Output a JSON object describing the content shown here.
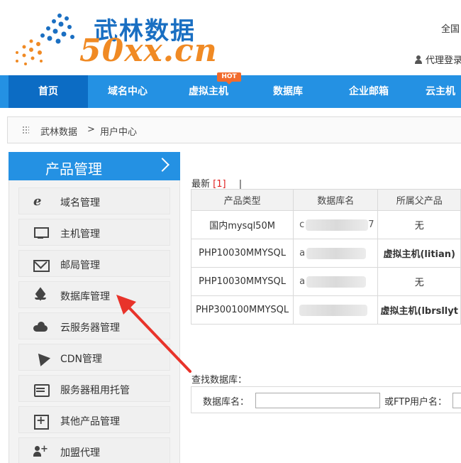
{
  "header": {
    "logo_cn": "武林数据",
    "logo_en": "50xx.cn",
    "top_right_line1": "全国",
    "top_right_line2": "代理登录"
  },
  "nav": {
    "items": [
      {
        "label": "首页",
        "active": true
      },
      {
        "label": "域名中心"
      },
      {
        "label": "虚拟主机",
        "badge": "HOT"
      },
      {
        "label": "数据库"
      },
      {
        "label": "企业邮箱"
      },
      {
        "label": "云主机"
      }
    ]
  },
  "breadcrumb": {
    "home": "武林数据",
    "separator": ">",
    "current": "用户中心"
  },
  "sidebar": {
    "title": "产品管理",
    "items": [
      {
        "label": "域名管理",
        "icon": "ie-icon"
      },
      {
        "label": "主机管理",
        "icon": "monitor-icon"
      },
      {
        "label": "邮局管理",
        "icon": "mail-icon"
      },
      {
        "label": "数据库管理",
        "icon": "layers-icon"
      },
      {
        "label": "云服务器管理",
        "icon": "cloud-icon"
      },
      {
        "label": "CDN管理",
        "icon": "cursor-icon"
      },
      {
        "label": "服务器租用托管",
        "icon": "server-icon"
      },
      {
        "label": "其他产品管理",
        "icon": "plus-square-icon"
      },
      {
        "label": "加盟代理",
        "icon": "add-user-icon"
      }
    ]
  },
  "main": {
    "latest_label": "最新",
    "latest_count": "[1]",
    "latest_sep": "|",
    "table": {
      "headers": [
        "产品类型",
        "数据库名",
        "所属父产品"
      ],
      "rows": [
        {
          "type": "国内mysql50M",
          "db_prefix": "c",
          "db_suffix": "7",
          "parent": "无"
        },
        {
          "type": "PHP10030MMYSQL",
          "db_prefix": "a",
          "db_suffix": "",
          "parent": "虚拟主机(litian)"
        },
        {
          "type": "PHP10030MMYSQL",
          "db_prefix": "a",
          "db_suffix": "",
          "parent": "无"
        },
        {
          "type": "PHP300100MMYSQL",
          "db_prefix": "",
          "db_suffix": "",
          "parent": "虚拟主机(lbrsllyt"
        }
      ]
    },
    "search": {
      "title": "查找数据库：",
      "db_name_label": "数据库名：",
      "db_name_value": "",
      "ftp_label": "或FTP用户名：",
      "ftp_value": ""
    }
  },
  "colors": {
    "nav_blue": "#2491e3",
    "nav_active": "#0c6cc4",
    "logo_blue": "#1a6fc2",
    "logo_orange": "#f08a24",
    "hot_badge": "#f26b2c",
    "arrow_red": "#e8332a"
  }
}
